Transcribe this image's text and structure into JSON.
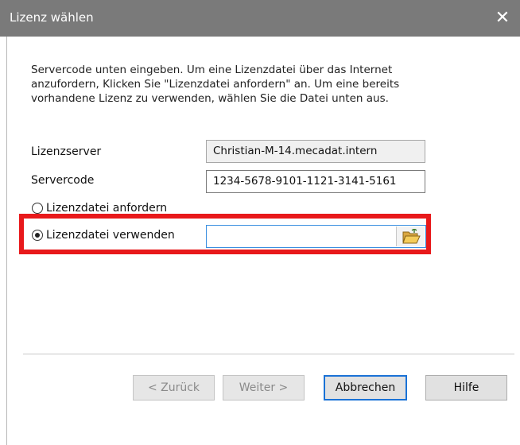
{
  "window": {
    "title": "Lizenz wählen",
    "close_glyph": "✕"
  },
  "instructions": [
    "Servercode unten eingeben. Um eine Lizenzdatei über das Internet",
    "anzufordern, Klicken Sie \"Lizenzdatei anfordern\" an. Um eine bereits",
    "vorhandene Lizenz zu verwenden, wählen Sie die Datei unten aus."
  ],
  "form": {
    "license_server_label": "Lizenzserver",
    "license_server_value": "Christian-M-14.mecadat.intern",
    "server_code_label": "Servercode",
    "server_code_value": "1234-5678-9101-1121-3141-5161",
    "option_request_label": "Lizenzdatei anfordern",
    "option_use_label": "Lizenzdatei verwenden",
    "selected_option": "use",
    "file_path_value": ""
  },
  "buttons": {
    "back_label": "< Zurück",
    "next_label": "Weiter >",
    "cancel_label": "Abbrechen",
    "help_label": "Hilfe"
  },
  "colors": {
    "titlebar": "#7a7a7a",
    "highlight": "#e8191b",
    "focus_border": "#1a72d6"
  },
  "icons": {
    "close": "close-icon",
    "browse": "folder-open-icon"
  }
}
